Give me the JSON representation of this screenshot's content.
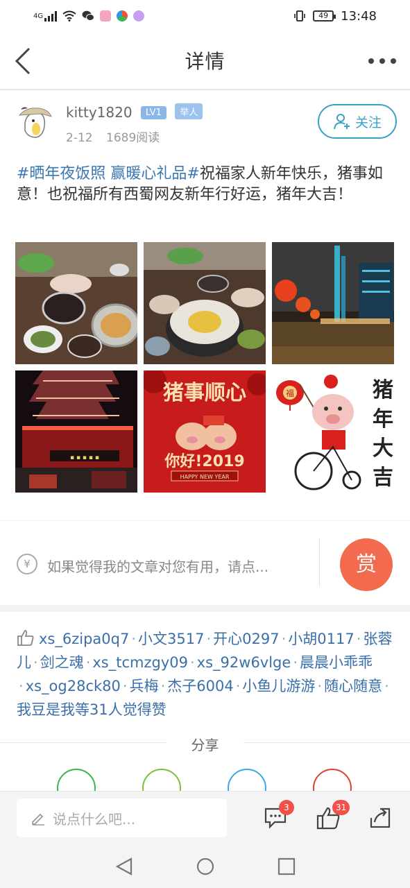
{
  "status_bar": {
    "network": "4G",
    "battery": "49",
    "time": "13:48"
  },
  "nav": {
    "title": "详情"
  },
  "author": {
    "name": "kitty1820",
    "level_badge": "LV1",
    "role_badge": "举人",
    "date": "2-12",
    "reads": "1689阅读",
    "follow_label": "关注"
  },
  "post": {
    "hashtag": "#晒年夜饭照  赢暖心礼品#",
    "body": "祝福家人新年快乐，猪事如意！也祝福所有西蜀网友新年行好运，猪年大吉！"
  },
  "photos": [
    {
      "alt": "hotpot-dinner-1"
    },
    {
      "alt": "hotpot-dinner-2"
    },
    {
      "alt": "night-city-lanterns"
    },
    {
      "alt": "lit-pagoda-restaurant"
    },
    {
      "alt": "pig-greeting-card",
      "caption_top": "猪事顺心",
      "caption_mid": "你好!2019",
      "caption_bottom": "HAPPY NEW YEAR"
    },
    {
      "alt": "pig-on-bicycle",
      "caption": "猪年大吉",
      "lantern_char": "福"
    }
  ],
  "reward": {
    "currency_symbol": "¥",
    "hint": "如果觉得我的文章对您有用，请点...",
    "button_label": "赏"
  },
  "likes": {
    "users": [
      "xs_6zipa0q7",
      "小文3517",
      "开心0297",
      "小胡0117",
      "张蓉儿",
      "剑之魂",
      "xs_tcmzgy09",
      "xs_92w6vlge",
      "晨晨小乖乖",
      "xs_og28ck80",
      "兵梅",
      "杰子6004",
      "小鱼儿游游",
      "随心随意",
      "我豆是我"
    ],
    "summary": "等31人觉得赞"
  },
  "share": {
    "label": "分享"
  },
  "bottom_bar": {
    "comment_placeholder": "说点什么吧...",
    "comment_count": "3",
    "like_count": "31"
  },
  "colors": {
    "accent_blue": "#3aa0c8",
    "link_blue": "#3a6fa8",
    "reward_orange": "#f26b4e",
    "badge_red": "#f0514a"
  }
}
